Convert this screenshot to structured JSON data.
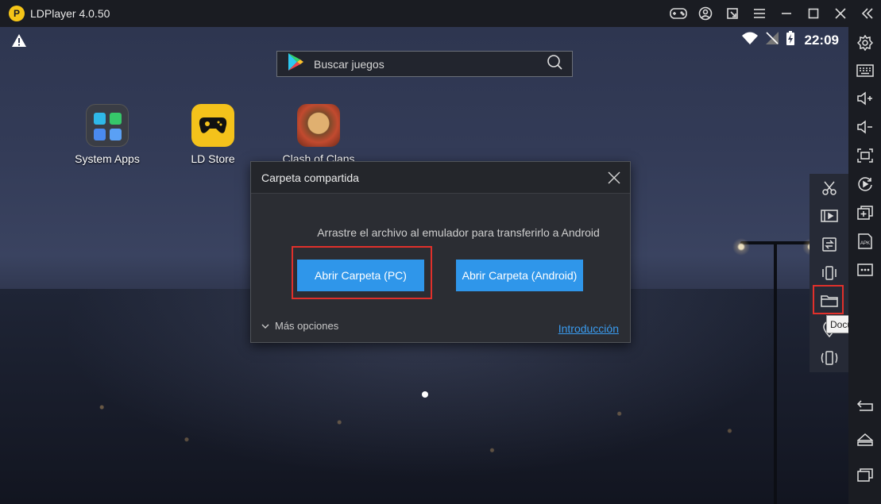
{
  "window": {
    "title": "LDPlayer 4.0.50",
    "logo_glyph": "P",
    "controls": [
      "gamepad-icon",
      "user-icon",
      "share-icon",
      "menu-icon",
      "minimize-icon",
      "maximize-icon",
      "close-icon",
      "collapse-icon"
    ]
  },
  "status_bar": {
    "time": "22:09",
    "icons": [
      "warning-icon",
      "wifi-icon",
      "no-signal-icon",
      "battery-charging-icon"
    ]
  },
  "search": {
    "placeholder": "Buscar juegos"
  },
  "apps": [
    {
      "label": "System Apps",
      "icon": "system-apps-icon"
    },
    {
      "label": "LD Store",
      "icon": "ld-store-icon"
    },
    {
      "label": "Clash of Clans",
      "icon": "clash-of-clans-icon"
    }
  ],
  "dialog": {
    "title": "Carpeta compartida",
    "message": "Arrastre el archivo al emulador para transferirlo a Android",
    "btn_pc": "Abrir Carpeta (PC)",
    "btn_android": "Abrir Carpeta (Android)",
    "more_options": "Más opciones",
    "intro_link": "Introducción"
  },
  "float_toolbar": {
    "items": [
      "scissors-icon",
      "video-icon",
      "sync-icon",
      "shake-icon",
      "folder-icon",
      "location-icon",
      "rotate-shake-icon"
    ],
    "tooltip": "Documentos"
  },
  "sidebar": {
    "items": [
      "settings-icon",
      "keyboard-icon",
      "volume-up-icon",
      "volume-down-icon",
      "fullscreen-icon",
      "record-icon",
      "add-window-icon",
      "apk-icon",
      "more-icon"
    ],
    "nav": [
      "back-icon",
      "home-icon",
      "recents-icon"
    ],
    "apk_label": "APK"
  },
  "colors": {
    "accent_button": "#2f96ea",
    "highlight": "#e0302b",
    "link": "#3a9cf0",
    "ld_yellow": "#f4c21b"
  }
}
